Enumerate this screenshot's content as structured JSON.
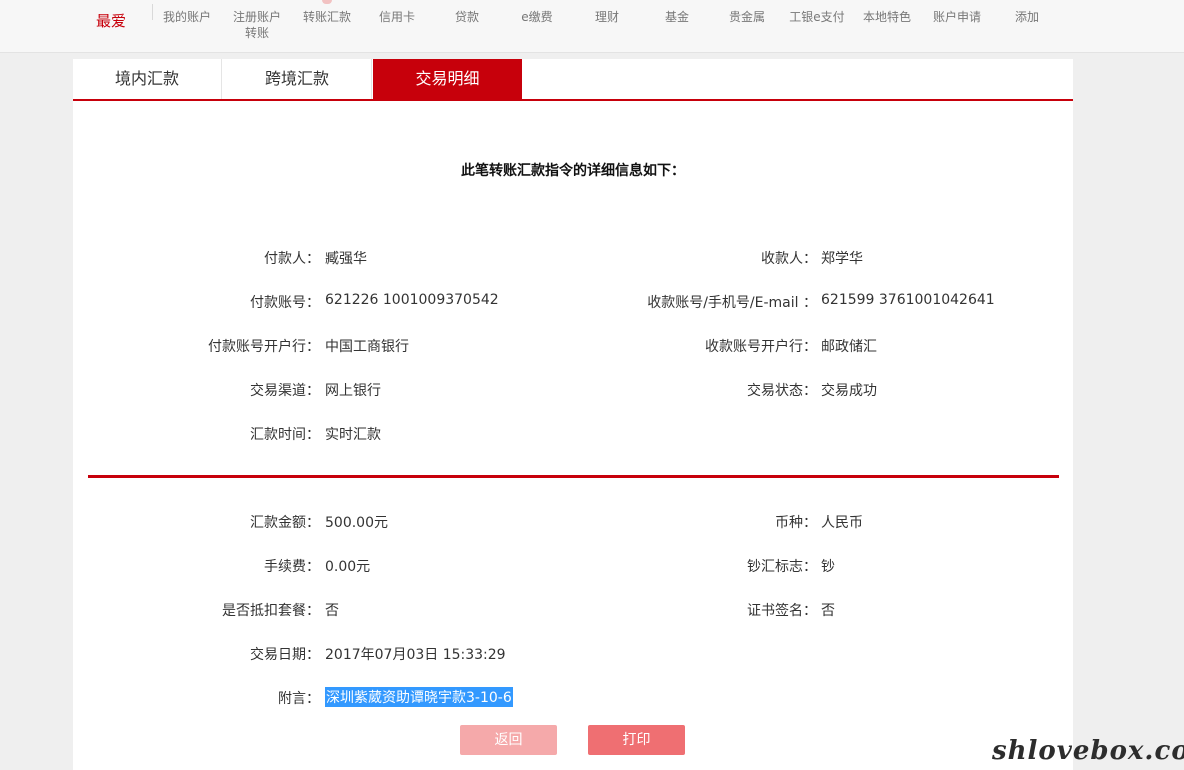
{
  "nav": {
    "favorite": "最爱",
    "items": [
      "我的账户",
      "注册账户\n转账",
      "转账汇款",
      "信用卡",
      "贷款",
      "e缴费",
      "理财",
      "基金",
      "贵金属",
      "工银e支付",
      "本地特色",
      "账户申请",
      "添加"
    ]
  },
  "tabs": [
    "境内汇款",
    "跨境汇款",
    "交易明细"
  ],
  "heading": "此笔转账汇款指令的详细信息如下：",
  "details": {
    "payer_label": "付款人：",
    "payer": "臧强华",
    "payee_label": "收款人：",
    "payee": "郑学华",
    "payer_account_label": "付款账号：",
    "payer_account": "621226 1001009370542",
    "payee_account_label": "收款账号/手机号/E-mail ：",
    "payee_account": "621599 3761001042641",
    "payer_bank_label": "付款账号开户行：",
    "payer_bank": "中国工商银行",
    "payee_bank_label": "收款账号开户行：",
    "payee_bank": "邮政储汇",
    "channel_label": "交易渠道：",
    "channel": "网上银行",
    "status_label": "交易状态：",
    "status": "交易成功",
    "remit_time_label": "汇款时间：",
    "remit_time": "实时汇款"
  },
  "amounts": {
    "amount_label": "汇款金额：",
    "amount": "500.00元",
    "currency_label": "币种：",
    "currency": "人民币",
    "fee_label": "手续费：",
    "fee": "0.00元",
    "cash_flag_label": "钞汇标志：",
    "cash_flag": "钞",
    "package_label": "是否抵扣套餐：",
    "package": "否",
    "cert_sign_label": "证书签名：",
    "cert_sign": "否",
    "date_label": "交易日期：",
    "date": "2017年07月03日 15:33:29",
    "remark_label": "附言：",
    "remark": "深圳紫葳资助谭晓宇款3-10-6"
  },
  "buttons": {
    "back": "返回",
    "print": "打印"
  },
  "watermark": "shlovebox.com",
  "colors": {
    "accent": "#c7000b",
    "back_button": "#f5a9aa",
    "print_button": "#ef6f72",
    "selection": "#3399ff"
  }
}
